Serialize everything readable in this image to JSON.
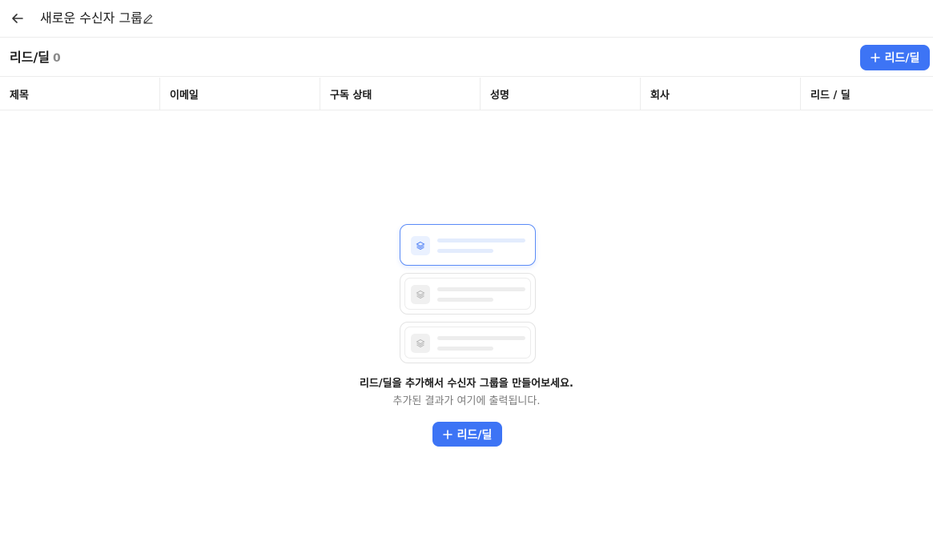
{
  "header": {
    "back_icon": "arrow-left-icon",
    "title": "새로운 수신자 그룹",
    "edit_icon": "pencil-icon"
  },
  "section": {
    "title": "리드/딜",
    "count": "0",
    "add_button_label": "리드/딜",
    "add_icon": "plus-icon"
  },
  "table": {
    "columns": [
      "제목",
      "이메일",
      "구독 상태",
      "성명",
      "회사",
      "리드 / 딜"
    ]
  },
  "empty_state": {
    "illustration_icon": "layers-icon",
    "title": "리드/딜을 추가해서 수신자 그룹을 만들어보세요.",
    "subtitle": "추가된 결과가 여기에 출력됩니다.",
    "add_button_label": "리드/딜"
  },
  "colors": {
    "accent": "#3d74f5",
    "border": "#ececec",
    "muted_text": "#7a7a7a"
  }
}
